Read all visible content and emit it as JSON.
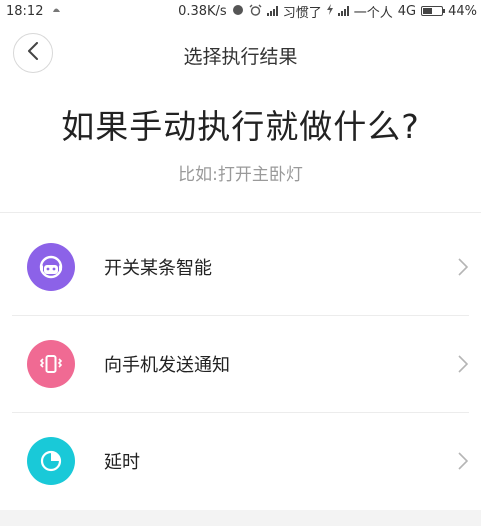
{
  "status_bar": {
    "time": "18:12",
    "speed": "0.38K/s",
    "carrier1": "习惯了",
    "carrier2": "一个人",
    "network": "4G",
    "battery": "44%",
    "battery_level": 0.44
  },
  "header": {
    "back_icon": "chevron-left-icon",
    "title": "选择执行结果"
  },
  "main": {
    "headline": "如果手动执行就做什么?",
    "hint": "比如:打开主卧灯"
  },
  "options": [
    {
      "label": "开关某条智能",
      "icon": "robot-icon",
      "color": "#8c62e8"
    },
    {
      "label": "向手机发送通知",
      "icon": "phone-vibrate-icon",
      "color": "#f06a93"
    },
    {
      "label": "延时",
      "icon": "timer-icon",
      "color": "#19c9d8"
    }
  ]
}
